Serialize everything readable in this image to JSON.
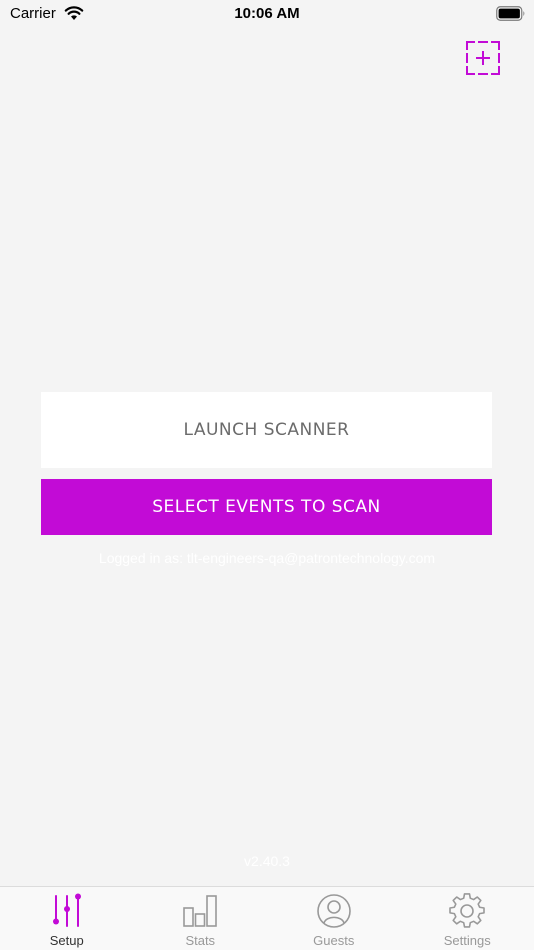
{
  "status_bar": {
    "carrier": "Carrier",
    "time": "10:06 AM"
  },
  "header": {
    "add_icon": "add-scan-icon"
  },
  "main": {
    "launch_label": "LAUNCH SCANNER",
    "select_label": "SELECT EVENTS TO SCAN",
    "logged_in": "Logged in as: tlt-engineers-qa@patrontechnology.com",
    "version": "v2.40.3"
  },
  "tabs": [
    {
      "label": "Setup",
      "icon": "sliders-icon",
      "active": true
    },
    {
      "label": "Stats",
      "icon": "bar-chart-icon",
      "active": false
    },
    {
      "label": "Guests",
      "icon": "user-circle-icon",
      "active": false
    },
    {
      "label": "Settings",
      "icon": "gear-icon",
      "active": false
    }
  ],
  "colors": {
    "accent": "#c20bd6",
    "background": "#f4f4f4",
    "tab_inactive": "#999999"
  }
}
